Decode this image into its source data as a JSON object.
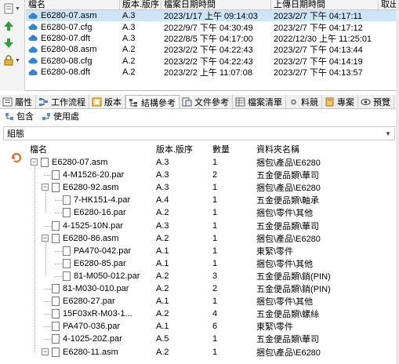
{
  "file_list": {
    "columns": [
      "檔名",
      "版本.版序",
      "檔案日期時間",
      "上傳日期時間",
      "取出"
    ],
    "rows": [
      {
        "name": "E6280-07.asm",
        "ver": "A.3",
        "file_date": "2023/1/17 上午 09:14:03",
        "upload_date": "2023/2/7 下午 04:17:11",
        "selected": true
      },
      {
        "name": "E6280-07.cfg",
        "ver": "A.3",
        "file_date": "2022/9/7 下午 04:30:49",
        "upload_date": "2023/2/7 下午 04:17:12",
        "selected": false
      },
      {
        "name": "E6280-07.dft",
        "ver": "A.3",
        "file_date": "2022/8/5 下午 04:17:00",
        "upload_date": "2022/12/30 上午 11:25:01",
        "selected": false
      },
      {
        "name": "E6280-08.asm",
        "ver": "A.2",
        "file_date": "2023/2/2 下午 04:22:43",
        "upload_date": "2023/2/7 下午 04:13:44",
        "selected": false
      },
      {
        "name": "E6280-08.cfg",
        "ver": "A.2",
        "file_date": "2023/2/2 下午 04:22:43",
        "upload_date": "2023/2/7 下午 04:14:19",
        "selected": false
      },
      {
        "name": "E6280-08.dft",
        "ver": "A.2",
        "file_date": "2023/2/2 上午 11:07:08",
        "upload_date": "2023/2/7 下午 04:13:57",
        "selected": false
      }
    ]
  },
  "tabs": [
    {
      "label": "屬性",
      "icon": "properties-icon"
    },
    {
      "label": "工作流程",
      "icon": "workflow-icon"
    },
    {
      "label": "版本",
      "icon": "version-icon"
    },
    {
      "label": "結構參考",
      "icon": "structure-icon",
      "active": true
    },
    {
      "label": "文件參考",
      "icon": "document-ref-icon"
    },
    {
      "label": "檔案清單",
      "icon": "file-list-icon"
    },
    {
      "label": "料競",
      "icon": "gear-icon"
    },
    {
      "label": "專案",
      "icon": "project-icon"
    },
    {
      "label": "預覽",
      "icon": "eye-icon"
    }
  ],
  "subtabs": [
    {
      "label": "包含",
      "icon": "contains-icon"
    },
    {
      "label": "使用處",
      "icon": "where-used-icon"
    }
  ],
  "group_bar": {
    "label": "組態"
  },
  "tree": {
    "columns": [
      "檔名",
      "版本.版序",
      "數量",
      "資料夾名稱"
    ],
    "rows": [
      {
        "name": "E6280-07.asm",
        "ver": "A.3",
        "qty": "1",
        "folder": "捆包\\產品\\E6280"
      },
      {
        "name": "4-M1526-20.par",
        "ver": "A.3",
        "qty": "2",
        "folder": "五金便品類\\華司"
      },
      {
        "name": "E6280-92.asm",
        "ver": "A.3",
        "qty": "1",
        "folder": "捆包\\產品\\E6280"
      },
      {
        "name": "7-HK151-4.par",
        "ver": "A.4",
        "qty": "1",
        "folder": "五金便品類\\軸承"
      },
      {
        "name": "E6280-16.par",
        "ver": "A.2",
        "qty": "1",
        "folder": "捆包\\零件\\其他"
      },
      {
        "name": "4-1525-10N.par",
        "ver": "A.3",
        "qty": "1",
        "folder": "五金便品類\\華司"
      },
      {
        "name": "E6280-86.asm",
        "ver": "A.2",
        "qty": "1",
        "folder": "捆包\\產品\\E6280"
      },
      {
        "name": "PA470-042.par",
        "ver": "A.1",
        "qty": "1",
        "folder": "東緊\\零件"
      },
      {
        "name": "E6280-85.par",
        "ver": "A.1",
        "qty": "1",
        "folder": "捆包\\零件\\其他"
      },
      {
        "name": "81-M050-012.par",
        "ver": "A.2",
        "qty": "3",
        "folder": "五金便品類\\銷(PIN)"
      },
      {
        "name": "81-M030-010.par",
        "ver": "A.2",
        "qty": "2",
        "folder": "五金便品類\\銷(PIN)"
      },
      {
        "name": "E6280-27.par",
        "ver": "A.1",
        "qty": "1",
        "folder": "捆包\\零件\\其他"
      },
      {
        "name": "15F03xR-M03-1...",
        "ver": "A.2",
        "qty": "4",
        "folder": "五金便品類\\螺絲"
      },
      {
        "name": "PA470-036.par",
        "ver": "A.1",
        "qty": "6",
        "folder": "東緊\\零件"
      },
      {
        "name": "4-1025-20Z.par",
        "ver": "A.5",
        "qty": "1",
        "folder": "五金便品類\\華司"
      },
      {
        "name": "E6280-11.asm",
        "ver": "A.2",
        "qty": "1",
        "folder": "捆包\\產品\\E6280"
      }
    ]
  },
  "colors": {
    "selected_row": "#cde6f7",
    "cloud": "#2f86d6",
    "accent": "#2f86d6"
  }
}
